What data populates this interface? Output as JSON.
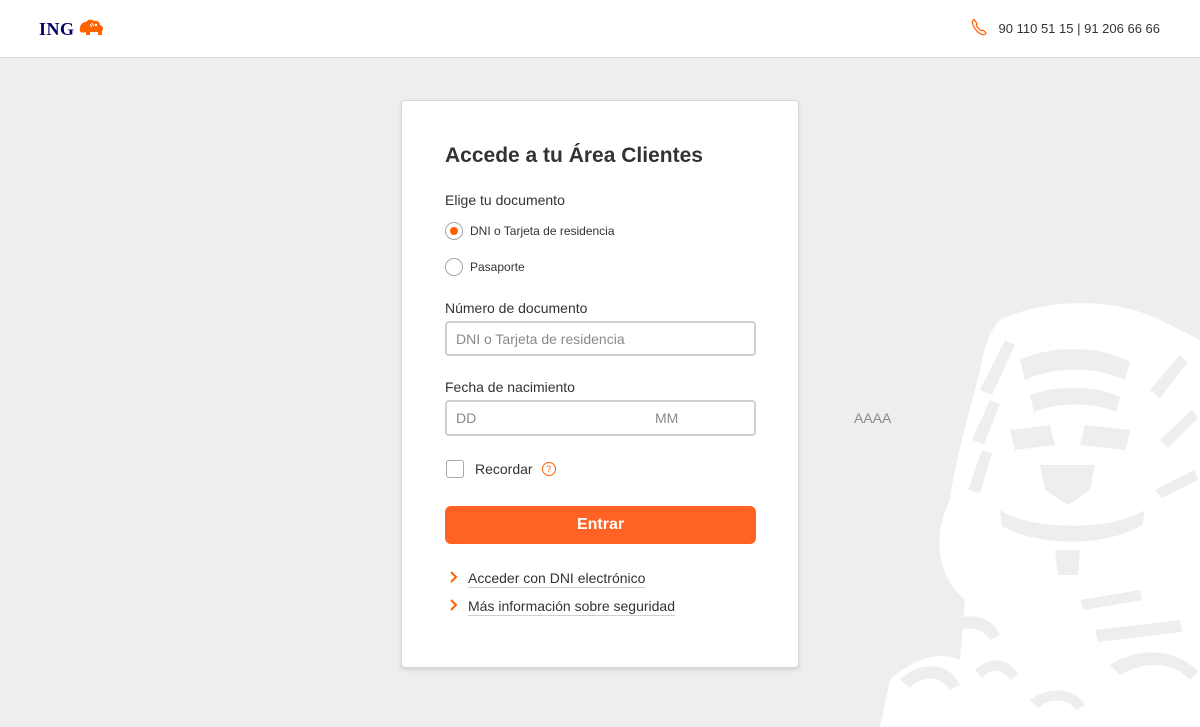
{
  "header": {
    "logo_text": "ING",
    "phone_text": "90 110 51 15 | 91 206 66 66"
  },
  "form": {
    "title": "Accede a tu Área Clientes",
    "document_label": "Elige tu documento",
    "options": [
      {
        "label": "DNI o Tarjeta de residencia",
        "checked": true
      },
      {
        "label": "Pasaporte",
        "checked": false
      }
    ],
    "doc_number_label": "Número de documento",
    "doc_number_placeholder": "DNI o Tarjeta de residencia",
    "doc_number_value": "",
    "birthdate_label": "Fecha de nacimiento",
    "day_placeholder": "DD",
    "month_placeholder": "MM",
    "year_placeholder": "AAAA",
    "remember_label": "Recordar",
    "remember_checked": false,
    "help_glyph": "?",
    "submit_label": "Entrar",
    "links": [
      {
        "label": "Acceder con DNI electrónico"
      },
      {
        "label": "Más información sobre seguridad"
      }
    ]
  },
  "colors": {
    "accent": "#ff6200",
    "brand_blue": "#000066",
    "background": "#eeeeee"
  },
  "icons": {
    "logo": "ing-lion-logo-icon",
    "phone": "phone-icon",
    "link_arrow": "chevron-right-icon",
    "help": "question-circle-icon",
    "background": "lion-watermark-icon"
  }
}
